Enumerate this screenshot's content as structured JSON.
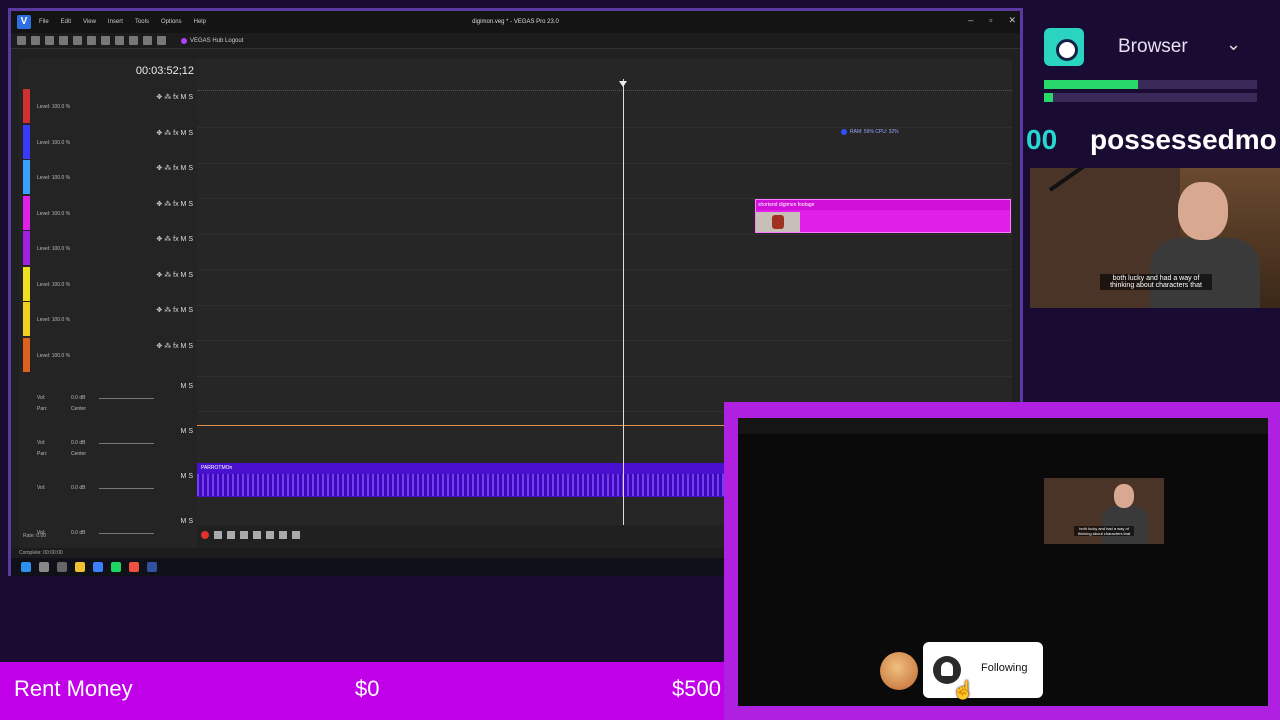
{
  "vegas": {
    "title": "digimon.veg * - VEGAS Pro 23.0",
    "app_logo": "V",
    "menu": [
      "File",
      "Edit",
      "View",
      "Insert",
      "Tools",
      "Options",
      "Help"
    ],
    "hub_label": "VEGAS Hub Logout",
    "timecode": "00:03:52;12",
    "track_level": "Level: 100.0 %",
    "track_buttons": "✥ ⁂ fx M S",
    "tracks": [
      {
        "color": "#d03030"
      },
      {
        "color": "#3a3aff"
      },
      {
        "color": "#3aa0ff"
      },
      {
        "color": "#e020e8"
      },
      {
        "color": "#a020e0"
      },
      {
        "color": "#f0e020"
      },
      {
        "color": "#f0d020"
      },
      {
        "color": "#e06020"
      }
    ],
    "audio": {
      "vol_label": "Vol:",
      "vol_value": "0.0 dB",
      "pan_label": "Pan:",
      "pan_value": "Center",
      "ms": "M S"
    },
    "clip_title": "shortend digimon footage",
    "audio_clip_title": "PARROTMOn",
    "ram_cpu": "RAM: 59%  CPU: 32%",
    "rate": "Rate: 0.00",
    "status": "Complete: 00:00:00",
    "colors": {
      "accent": "#5a3aa0",
      "clip": "#e020e8",
      "audio_clip": "#4a10d0"
    }
  },
  "overlay": {
    "browser_label": "Browser",
    "chevron_icon": "chevron-down-icon",
    "bars": [
      0.44,
      0.04
    ],
    "tts_amount": "00",
    "tts_name": "possessedmo",
    "caption": "both lucky and had a way of thinking about characters that",
    "follow_label": "Following",
    "rent_label": "Rent Money",
    "rent_current": "$0",
    "rent_goal": "$500"
  }
}
